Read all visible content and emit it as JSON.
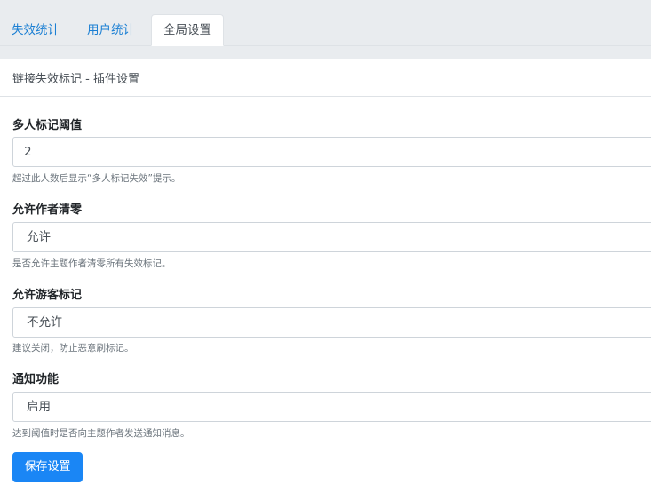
{
  "tabs": [
    {
      "label": "失效统计",
      "active": false
    },
    {
      "label": "用户统计",
      "active": false
    },
    {
      "label": "全局设置",
      "active": true
    }
  ],
  "panel": {
    "title": "链接失效标记 - 插件设置"
  },
  "fields": {
    "threshold": {
      "label": "多人标记阈值",
      "value": "2",
      "help": "超过此人数后显示“多人标记失效”提示。"
    },
    "author_clear": {
      "label": "允许作者清零",
      "value": "允许",
      "help": "是否允许主题作者清零所有失效标记。"
    },
    "guest_mark": {
      "label": "允许游客标记",
      "value": "不允许",
      "help": "建议关闭，防止恶意刷标记。"
    },
    "notify": {
      "label": "通知功能",
      "value": "启用",
      "help": "达到阈值时是否向主题作者发送通知消息。"
    }
  },
  "actions": {
    "save_label": "保存设置"
  },
  "colors": {
    "tab_link": "#1b7fd3",
    "primary_button": "#1a86f5",
    "tabbar_bg": "#e9ecef"
  }
}
